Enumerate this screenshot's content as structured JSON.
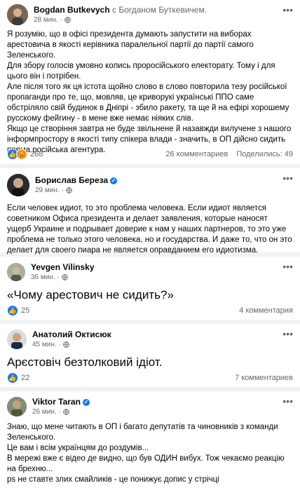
{
  "posts": [
    {
      "author": "Bogdan Butkevych",
      "with": "с Богданом Буткевичем.",
      "time": "28 мин.",
      "paragraphs": [
        "Я розумію, що в офісі президента думають запустити на виборах арестовича в якості керівника паралельної партії до партії самого Зеленського.",
        "Для збору голосів умовно колись проросійського електорату. Тому і для цього він і потрібен.",
        "Але після того як ця істота щойно слово в слово повторила тезу російської пропаганди про те, що, мовляв, це криворукі українські ППО саме обстріляло свій будинок в Дніпрі - збило ракету, та ще й на ефірі хорошему русскому фейгину - в мене вже немає ніяких слів.",
        "Якщо це створіння завтра не буде звільнене й назавжди вилучене з нашого інформпростору в якості типу спікера влади - значить, в ОП дійсно сидить пряма російська агентура."
      ],
      "reactions": "268",
      "comments": "26 комментариев",
      "shares": "Поделились: 49"
    },
    {
      "author": "Борислав Береза",
      "time": "29 мин.",
      "paragraphs": [
        "Если человек идиот, то это проблема человека. Если идиот является советником Офиса президента и делает заявления, которые наносят ущерб Украине и подрывает доверие к нам у наших партнеров, то это уже проблема не только этого человека, но и государства. И даже то, что он это делает для своего пиара не является оправданием его идиотизма."
      ]
    },
    {
      "author": "Yevgen Vilinsky",
      "time": "36 мин.",
      "big_text": "«Чому арестович не сидить?»",
      "reactions": "25",
      "comments": "4 комментария"
    },
    {
      "author": "Анатолий Октисюк",
      "time": "45 мин.",
      "big_text": "Арєстовіч безтолковий ідіот.",
      "reactions": "22",
      "comments": "7 комментариев"
    },
    {
      "author": "Viktor Taran",
      "time": "26 мин.",
      "paragraphs": [
        "Знаю, що мене читають в ОП і багато депутатів та чиновників з команди Зеленського.",
        "Це вам і всім українцям до роздумів...",
        "В мережі вже є відео де видно, що був ОДИН вибух. Тож чекаємо реакцію на брехню...",
        "ps не ставте злих смайликів - це понижує допис у стрічці"
      ]
    }
  ],
  "icons": {
    "more": "more-dots-icon",
    "audience": "globe-icon",
    "like": "like-icon",
    "angry": "angry-icon",
    "verified": "verified-badge-icon"
  }
}
